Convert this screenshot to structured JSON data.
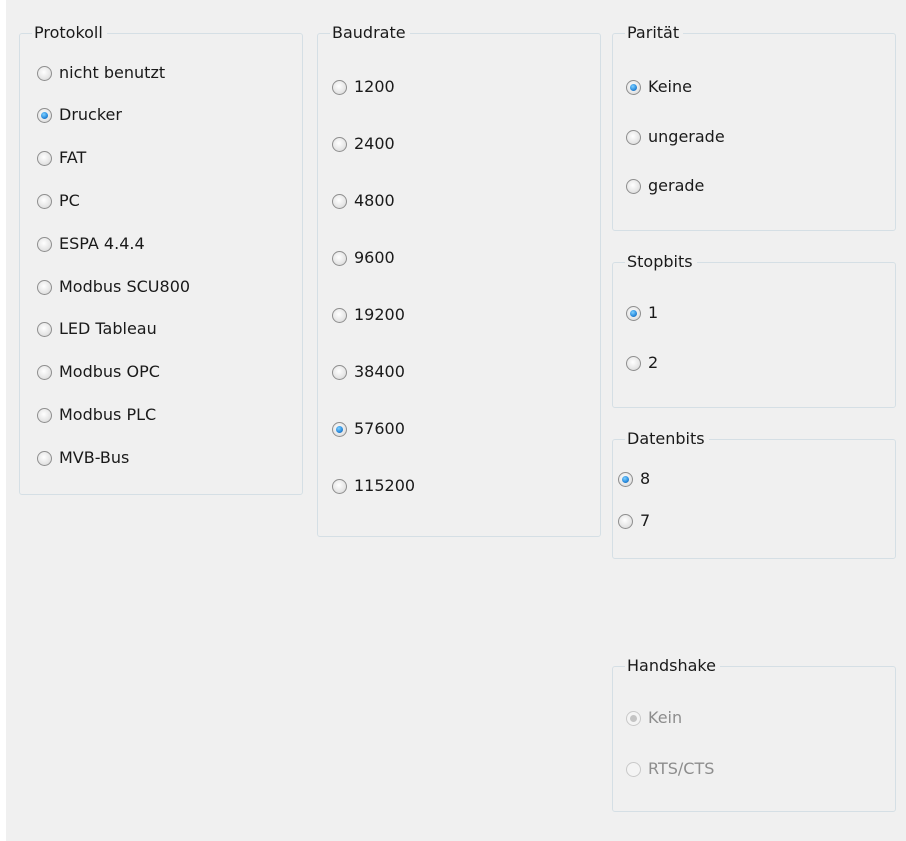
{
  "protokoll": {
    "title": "Protokoll",
    "options": [
      {
        "label": "nicht benutzt",
        "checked": false
      },
      {
        "label": "Drucker",
        "checked": true
      },
      {
        "label": "FAT",
        "checked": false
      },
      {
        "label": "PC",
        "checked": false
      },
      {
        "label": "ESPA 4.4.4",
        "checked": false
      },
      {
        "label": "Modbus SCU800",
        "checked": false
      },
      {
        "label": "LED Tableau",
        "checked": false
      },
      {
        "label": "Modbus OPC",
        "checked": false
      },
      {
        "label": "Modbus PLC",
        "checked": false
      },
      {
        "label": "MVB-Bus",
        "checked": false
      }
    ]
  },
  "baudrate": {
    "title": "Baudrate",
    "options": [
      {
        "label": "1200",
        "checked": false
      },
      {
        "label": "2400",
        "checked": false
      },
      {
        "label": "4800",
        "checked": false
      },
      {
        "label": "9600",
        "checked": false
      },
      {
        "label": "19200",
        "checked": false
      },
      {
        "label": "38400",
        "checked": false
      },
      {
        "label": "57600",
        "checked": true
      },
      {
        "label": "115200",
        "checked": false
      }
    ]
  },
  "paritaet": {
    "title": "Parität",
    "options": [
      {
        "label": "Keine",
        "checked": true
      },
      {
        "label": "ungerade",
        "checked": false
      },
      {
        "label": "gerade",
        "checked": false
      }
    ]
  },
  "stopbits": {
    "title": "Stopbits",
    "options": [
      {
        "label": "1",
        "checked": true
      },
      {
        "label": "2",
        "checked": false
      }
    ]
  },
  "datenbits": {
    "title": "Datenbits",
    "options": [
      {
        "label": "8",
        "checked": true
      },
      {
        "label": "7",
        "checked": false
      }
    ]
  },
  "handshake": {
    "title": "Handshake",
    "disabled": true,
    "options": [
      {
        "label": "Kein",
        "checked": true
      },
      {
        "label": "RTS/CTS",
        "checked": false
      }
    ]
  }
}
